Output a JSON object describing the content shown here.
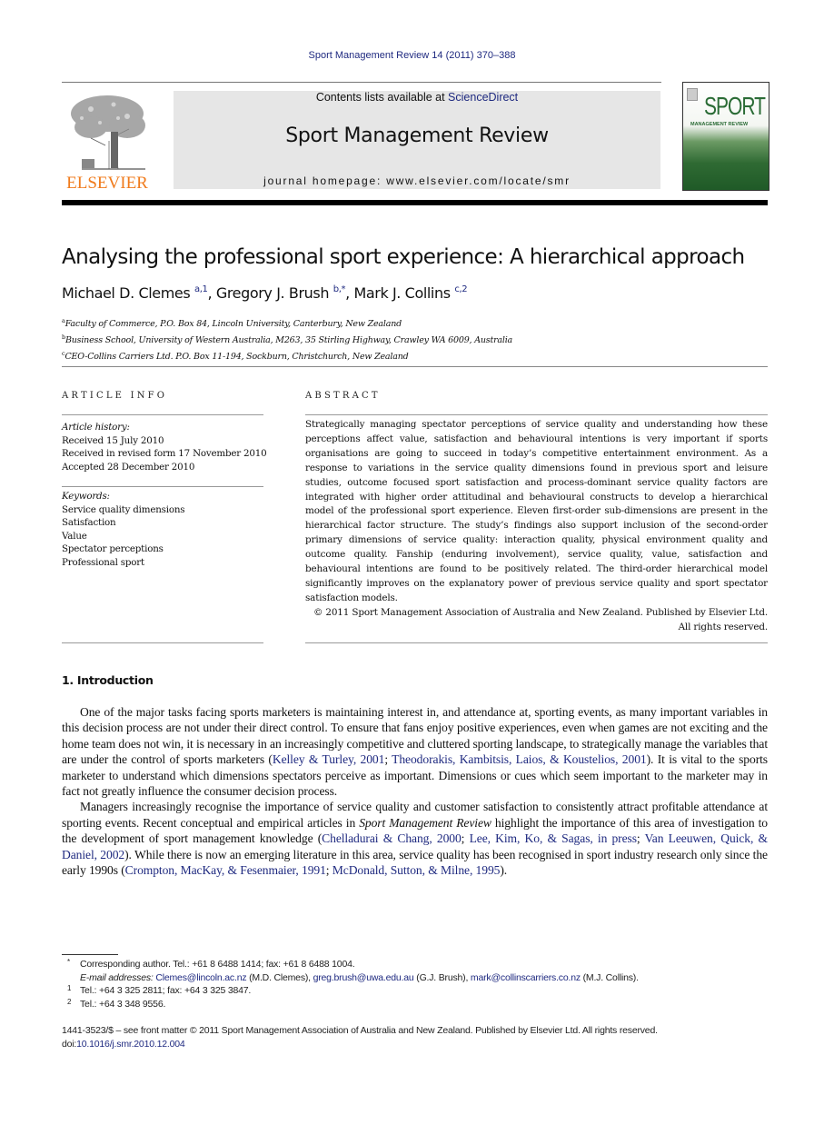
{
  "running_head": "Sport Management Review 14 (2011) 370–388",
  "publisher": {
    "wordmark": "ELSEVIER",
    "brand_color": "#f07b1c"
  },
  "masthead": {
    "contents_prefix": "Contents lists available at ",
    "contents_link": "ScienceDirect",
    "journal_title": "Sport Management Review",
    "homepage": "journal homepage: www.elsevier.com/locate/smr"
  },
  "cover": {
    "title": "SPORT",
    "subtitle": "MANAGEMENT REVIEW"
  },
  "article": {
    "title": "Analysing the professional sport experience: A hierarchical approach",
    "authors": [
      {
        "name": "Michael D. Clemes",
        "sup": "a,1",
        "sep": ", "
      },
      {
        "name": "Gregory J. Brush",
        "sup": "b,*",
        "sep": ", "
      },
      {
        "name": "Mark J. Collins",
        "sup": "c,2",
        "sep": ""
      }
    ],
    "affiliations": [
      {
        "mark": "a",
        "text": "Faculty of Commerce, P.O. Box 84, Lincoln University, Canterbury, New Zealand"
      },
      {
        "mark": "b",
        "text": "Business School, University of Western Australia, M263, 35 Stirling Highway, Crawley WA 6009, Australia"
      },
      {
        "mark": "c",
        "text": "CEO-Collins Carriers Ltd. P.O. Box 11-194, Sockburn, Christchurch, New Zealand"
      }
    ]
  },
  "article_info": {
    "heading": "ARTICLE INFO",
    "history_label": "Article history:",
    "history": [
      "Received 15 July 2010",
      "Received in revised form 17 November 2010",
      "Accepted 28 December 2010"
    ],
    "keywords_label": "Keywords:",
    "keywords": [
      "Service quality dimensions",
      "Satisfaction",
      "Value",
      "Spectator perceptions",
      "Professional sport"
    ]
  },
  "abstract": {
    "heading": "ABSTRACT",
    "text": "Strategically managing spectator perceptions of service quality and understanding how these perceptions affect value, satisfaction and behavioural intentions is very important if sports organisations are going to succeed in today’s competitive entertainment environment. As a response to variations in the service quality dimensions found in previous sport and leisure studies, outcome focused sport satisfaction and process-dominant service quality factors are integrated with higher order attitudinal and behavioural constructs to develop a hierarchical model of the professional sport experience. Eleven first-order sub-dimensions are present in the hierarchical factor structure. The study’s findings also support inclusion of the second-order primary dimensions of service quality: interaction quality, physical environment quality and outcome quality. Fanship (enduring involvement), service quality, value, satisfaction and behavioural intentions are found to be positively related. The third-order hierarchical model significantly improves on the explanatory power of previous service quality and sport spectator satisfaction models.",
    "copyright": "© 2011 Sport Management Association of Australia and New Zealand. Published by Elsevier Ltd. All rights reserved."
  },
  "introduction": {
    "heading": "1. Introduction",
    "p1": {
      "a": "One of the major tasks facing sports marketers is maintaining interest in, and attendance at, sporting events, as many important variables in this decision process are not under their direct control. To ensure that fans enjoy positive experiences, even when games are not exciting and the home team does not win, it is necessary in an increasingly competitive and cluttered sporting landscape, to strategically manage the variables that are under the control of sports marketers (",
      "cite1": "Kelley & Turley, 2001",
      "sep1": "; ",
      "cite2": "Theodorakis, Kambitsis, Laios, & Koustelios, 2001",
      "b": "). It is vital to the sports marketer to understand which dimensions spectators perceive as important. Dimensions or cues which seem important to the marketer may in fact not greatly influence the consumer decision process."
    },
    "p2": {
      "a": "Managers increasingly recognise the importance of service quality and customer satisfaction to consistently attract profitable attendance at sporting events. Recent conceptual and empirical articles in ",
      "journal": "Sport Management Review",
      "b": " highlight the importance of this area of investigation to the development of sport management knowledge (",
      "cite1": "Chelladurai & Chang, 2000",
      "sep1": "; ",
      "cite2": "Lee, Kim, Ko, & Sagas, in press",
      "sep2": "; ",
      "cite3": "Van Leeuwen, Quick, & Daniel, 2002",
      "c": "). While there is now an emerging literature in this area, service quality has been recognised in sport industry research only since the early 1990s (",
      "cite4": "Crompton, MacKay, & Fesenmaier, 1991",
      "sep3": "; ",
      "cite5": "McDonald, Sutton, & Milne, 1995",
      "d": ")."
    }
  },
  "footnotes": {
    "corresponding": {
      "mark": "*",
      "text": "Corresponding author. Tel.: +61 8 6488 1414; fax: +61 8 6488 1004."
    },
    "emails": {
      "label": "E-mail addresses:",
      "items": [
        {
          "email": "Clemes@lincoln.ac.nz",
          "who": " (M.D. Clemes), "
        },
        {
          "email": "greg.brush@uwa.edu.au",
          "who": " (G.J. Brush), "
        },
        {
          "email": "mark@collinscarriers.co.nz",
          "who": " (M.J. Collins)."
        }
      ]
    },
    "fn1": {
      "mark": "1",
      "text": "Tel.: +64 3 325 2811; fax: +64 3 325 3847."
    },
    "fn2": {
      "mark": "2",
      "text": "Tel.: +64 3 348 9556."
    }
  },
  "front_matter": {
    "line": "1441-3523/$ – see front matter © 2011 Sport Management Association of Australia and New Zealand. Published by Elsevier Ltd. All rights reserved.",
    "doi_prefix": "doi:",
    "doi": "10.1016/j.smr.2010.12.004"
  }
}
